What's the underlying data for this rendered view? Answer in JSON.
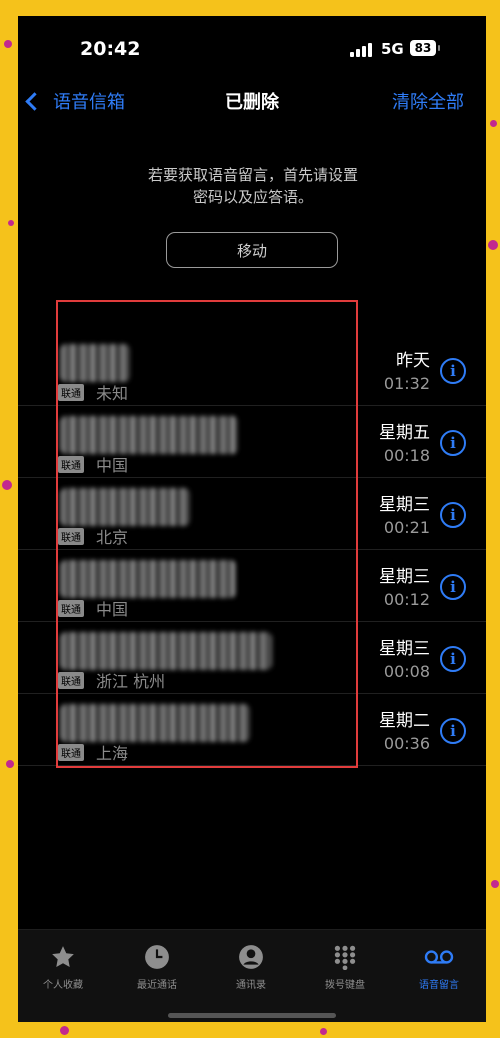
{
  "status": {
    "time": "20:42",
    "network": "5G",
    "battery": "83"
  },
  "nav": {
    "back_label": "语音信箱",
    "title": "已删除",
    "clear_all": "清除全部"
  },
  "notice": {
    "line1": "若要获取语音留言，首先请设置",
    "line2": "密码以及应答语。"
  },
  "move_button": "移动",
  "voicemails": [
    {
      "carrier": "联通",
      "location": "未知",
      "day": "昨天",
      "duration": "01:32"
    },
    {
      "carrier": "联通",
      "location": "中国",
      "day": "星期五",
      "duration": "00:18"
    },
    {
      "carrier": "联通",
      "location": "北京",
      "day": "星期三",
      "duration": "00:21"
    },
    {
      "carrier": "联通",
      "location": "中国",
      "day": "星期三",
      "duration": "00:12"
    },
    {
      "carrier": "联通",
      "location": "浙江 杭州",
      "day": "星期三",
      "duration": "00:08"
    },
    {
      "carrier": "联通",
      "location": "上海",
      "day": "星期二",
      "duration": "00:36"
    }
  ],
  "tabs": [
    {
      "label": "个人收藏",
      "icon": "star-icon"
    },
    {
      "label": "最近通话",
      "icon": "clock-icon"
    },
    {
      "label": "通讯录",
      "icon": "person-icon"
    },
    {
      "label": "拨号键盘",
      "icon": "keypad-icon"
    },
    {
      "label": "语音留言",
      "icon": "voicemail-icon"
    }
  ],
  "colors": {
    "accent": "#2f7cf6",
    "highlight_box": "#e13c3c",
    "frame": "#f5c21b"
  }
}
